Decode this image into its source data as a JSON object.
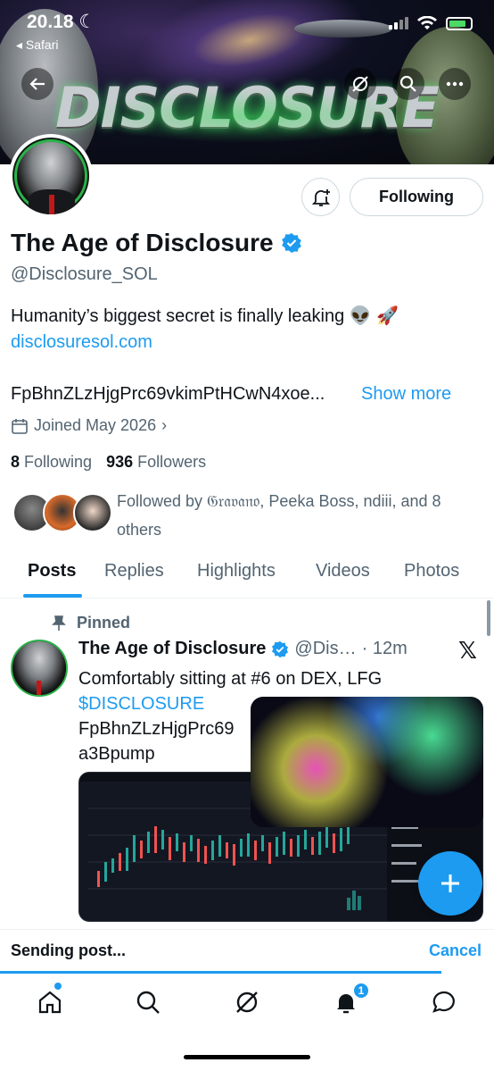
{
  "status": {
    "time": "20.18",
    "back_app": "Safari"
  },
  "banner": {
    "title": "DISCLOSURE"
  },
  "profile": {
    "name": "The Age of Disclosure",
    "handle": "@Disclosure_SOL",
    "bio": "Humanity’s biggest secret is finally leaking 👽 🚀",
    "link": "disclosuresol.com",
    "ca_text": "FpBhnZLzHjgPrc69vkimPtHCwN4xoe...",
    "show_more": "Show more",
    "joined": "Joined May 2026",
    "following_count": "8",
    "following_label": "Following",
    "followers_count": "936",
    "followers_label": "Followers",
    "followed_by": "Followed by 𝔊𝔯𝔞𝔳𝔞𝔫𝔬, Peeka Boss, ndiii, and 8 others",
    "follow_button": "Following"
  },
  "tabs": [
    {
      "label": "Posts"
    },
    {
      "label": "Replies"
    },
    {
      "label": "Highlights"
    },
    {
      "label": "Videos"
    },
    {
      "label": "Photos"
    }
  ],
  "post": {
    "pinned_label": "Pinned",
    "author": "The Age of Disclosure",
    "handle": "@Dis…",
    "time": "· 12m",
    "line1": "Comfortably sitting at #6 on DEX, LFG",
    "cashtag": "$DISCLOSURE",
    "line3": "FpBhnZLzHjgPrc69",
    "line4": "a3Bpump"
  },
  "sending": {
    "text": "Sending post...",
    "cancel": "Cancel"
  },
  "notifications": {
    "badge": "1"
  },
  "colors": {
    "accent": "#1d9bf0",
    "text": "#0f1419",
    "muted": "#536471"
  }
}
